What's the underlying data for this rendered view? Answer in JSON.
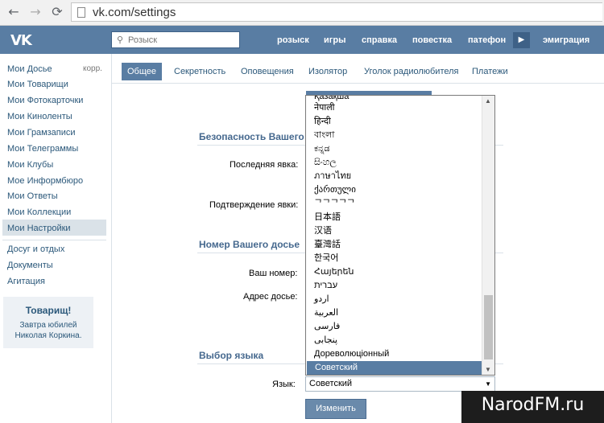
{
  "browser": {
    "url": "vk.com/settings",
    "back_icon": "back-arrow-icon",
    "forward_icon": "forward-arrow-icon",
    "reload_icon": "reload-icon"
  },
  "header": {
    "logo": "VK",
    "search_placeholder": "Розыск",
    "nav": [
      "розыск",
      "игры",
      "справка",
      "повестка",
      "патефон",
      "эмиграция"
    ],
    "colors": {
      "header_bg": "#597da3",
      "accent": "#45688e"
    }
  },
  "sidebar": {
    "items": [
      "Мои Досье",
      "Мои Товарищи",
      "Мои Фотокарточки",
      "Мои Киноленты",
      "Мои Грамзаписи",
      "Мои Телеграммы",
      "Мои Клубы",
      "Мое Информбюро",
      "Мои Ответы",
      "Мои Коллекции",
      "Мои Настройки"
    ],
    "corr_label": "корр.",
    "active": "Мои Настройки",
    "extra": [
      "Досуг и отдых",
      "Документы",
      "Агитация"
    ],
    "promo": {
      "title": "Товарищ!",
      "text_line1": "Завтра юбилей",
      "text_line2": "Николая Коркина."
    }
  },
  "tabs": [
    "Общее",
    "Секретность",
    "Оповещения",
    "Изолятор",
    "Уголок радиолюбителя",
    "Платежи"
  ],
  "active_tab": "Общее",
  "sections": {
    "security_title": "Безопасность Вашего д",
    "last_seen_label": "Последняя явка:",
    "confirm_label": "Подтверждение явки:",
    "dossier_title": "Номер Вашего досье",
    "number_label": "Ваш номер:",
    "address_label": "Адрес досье:",
    "lang_title": "Выбор языка",
    "lang_label": "Язык:",
    "lang_value": "Советский",
    "change_button": "Изменить"
  },
  "dropdown": {
    "options": [
      "Қазақша",
      "नेपाली",
      "हिन्दी",
      "বাংলা",
      "ಕನ್ನಡ",
      "සිංහල",
      "ภาษาไทย",
      "ქართული",
      "ᄀᄀᄀᄀᄀ",
      "日本語",
      "汉语",
      "臺灣話",
      "한국어",
      "Հայերեն",
      "עברית",
      "اردو",
      "العربية",
      "فارسی",
      "پنجابی",
      "Дореволюціонный",
      "Советский"
    ],
    "selected": "Советский"
  },
  "watermark": "NarodFM.ru"
}
